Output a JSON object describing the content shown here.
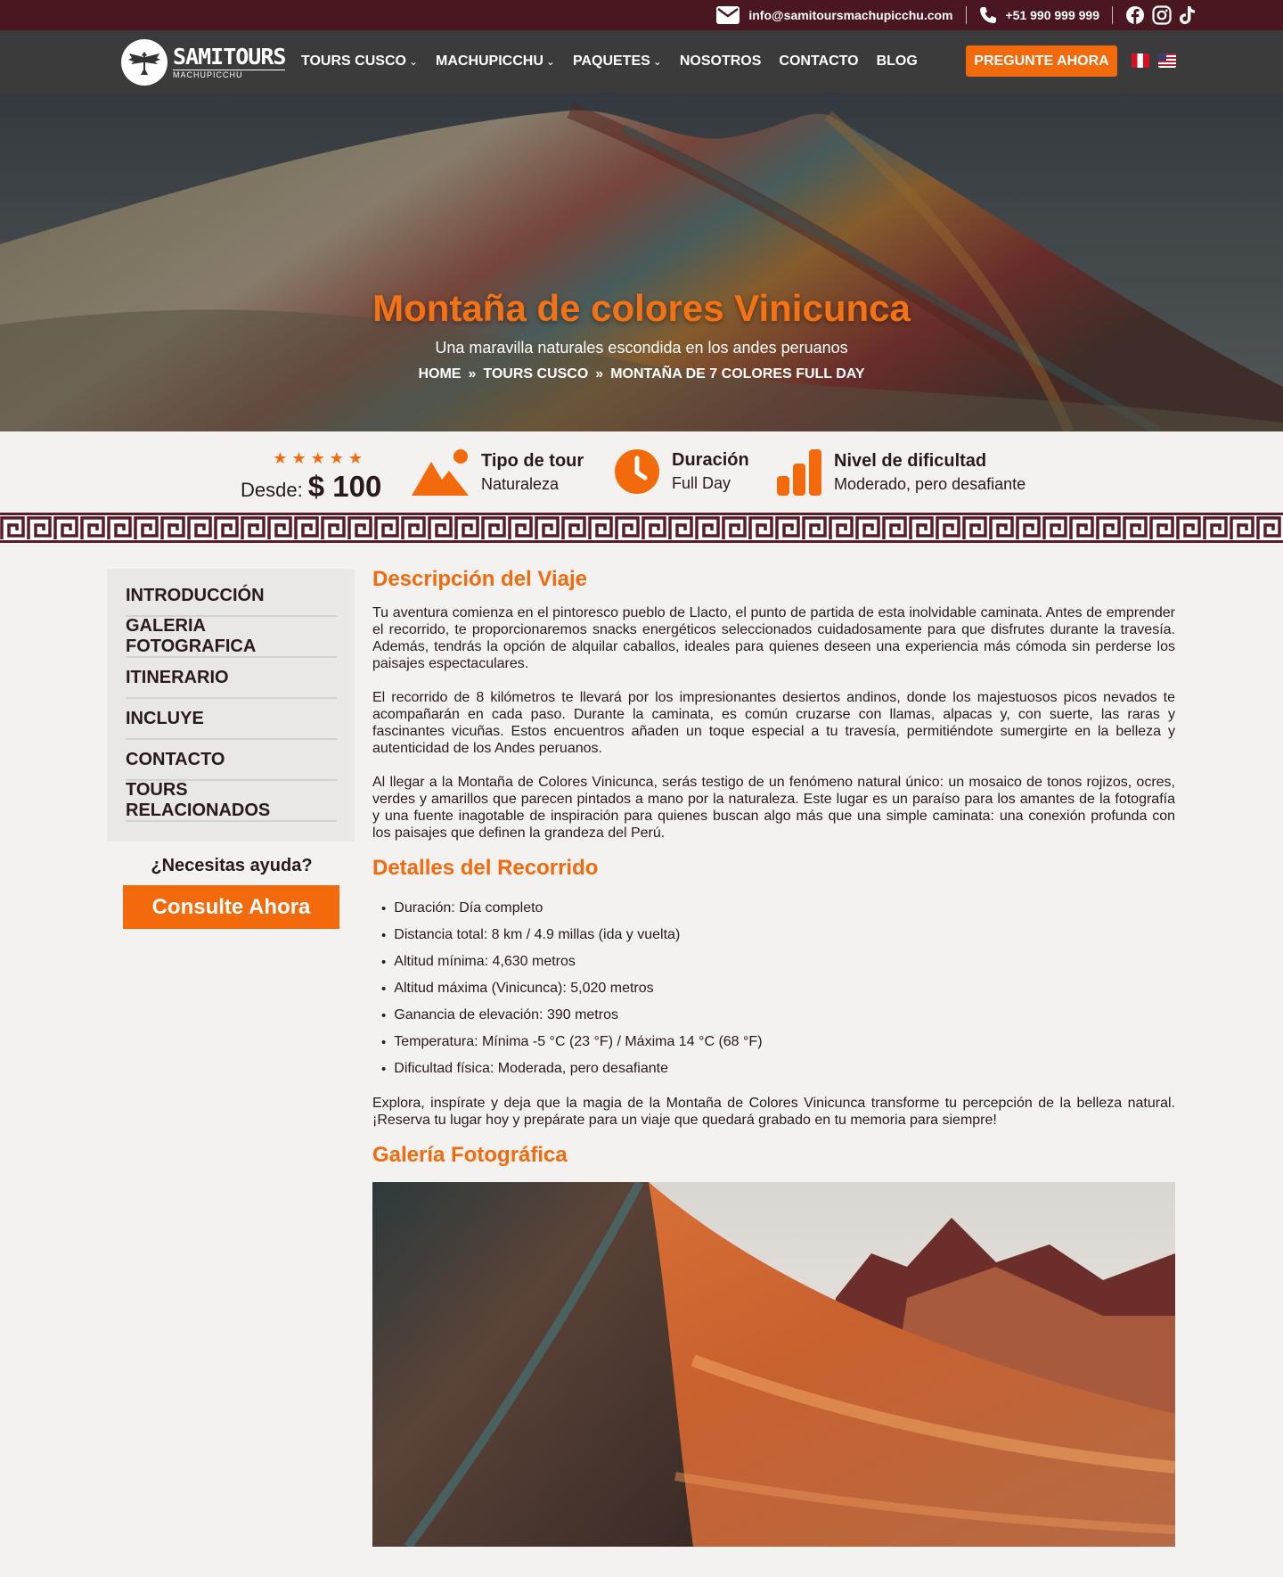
{
  "topbar": {
    "email": "info@samitoursmachupicchu.com",
    "phone": "+51 990 999 999",
    "socials": [
      "facebook-icon",
      "instagram-icon",
      "tiktok-icon"
    ]
  },
  "nav": {
    "logo_main": "SAMITOURS",
    "logo_sub": "MACHUPICCHU",
    "links": [
      "TOURS CUSCO",
      "MACHUPICCHU",
      "PAQUETES",
      "NOSOTROS",
      "CONTACTO",
      "BLOG"
    ],
    "cta": "PREGUNTE AHORA",
    "languages": [
      "peru-flag-icon",
      "usa-flag-icon"
    ]
  },
  "hero": {
    "title": "Montaña de colores Vinicunca",
    "subtitle": "Una maravilla naturales escondida en los andes peruanos",
    "breadcrumb": [
      "HOME",
      "TOURS CUSCO",
      "MONTAÑA DE 7 COLORES FULL DAY"
    ],
    "breadcrumb_sep": "»"
  },
  "info": {
    "rating": 5,
    "price_label": "Desde:",
    "price_value": "$ 100",
    "tour_type_title": "Tipo de tour",
    "tour_type_value": "Naturaleza",
    "duration_title": "Duración",
    "duration_value": "Full Day",
    "difficulty_title": "Nivel de dificultad",
    "difficulty_value": "Moderado, pero desafiante"
  },
  "sidebar": {
    "items": [
      "INTRODUCCIÓN",
      "GALERIA FOTOGRAFICA",
      "ITINERARIO",
      "INCLUYE",
      "CONTACTO",
      "TOURS RELACIONADOS"
    ],
    "help_title": "¿Necesitas ayuda?",
    "help_button": "Consulte Ahora"
  },
  "content": {
    "description_title": "Descripción del Viaje",
    "paragraphs": [
      "Tu aventura comienza en el pintoresco pueblo de Llacto, el punto de partida de esta inolvidable caminata. Antes de emprender el recorrido, te proporcionaremos snacks energéticos seleccionados cuidadosamente para que disfrutes durante la travesía. Además, tendrás la opción de alquilar caballos, ideales para quienes deseen una experiencia más cómoda sin perderse los paisajes espectaculares.",
      "El recorrido de 8 kilómetros te llevará por los impresionantes desiertos andinos, donde los majestuosos picos nevados te acompañarán en cada paso. Durante la caminata, es común cruzarse con llamas, alpacas y, con suerte, las raras y fascinantes vicuñas. Estos encuentros añaden un toque especial a tu travesía, permitiéndote sumergirte en la belleza y autenticidad de los Andes peruanos.",
      "Al llegar a la Montaña de Colores Vinicunca, serás testigo de un fenómeno natural único: un mosaico de tonos rojizos, ocres, verdes y amarillos que parecen pintados a mano por la naturaleza. Este lugar es un paraíso para los amantes de la fotografía y una fuente inagotable de inspiración para quienes buscan algo más que una simple caminata: una conexión profunda con los paisajes que definen la grandeza del Perú."
    ],
    "details_title": "Detalles del Recorrido",
    "details": [
      "Duración: Día completo",
      "Distancia total: 8 km / 4.9 millas (ida y vuelta)",
      "Altitud mínima: 4,630 metros",
      "Altitud máxima (Vinicunca): 5,020 metros",
      "Ganancia de elevación: 390 metros",
      "Temperatura: Mínima -5 °C (23 °F) / Máxima 14 °C (68 °F)",
      "Dificultad física: Moderada, pero desafiante"
    ],
    "closing": "Explora, inspírate y deja que la magia de la Montaña de Colores Vinicunca transforme tu percepción de la belleza natural. ¡Reserva tu lugar hoy y prepárate para un viaje que quedará grabado en tu memoria para siempre!",
    "gallery_title": "Galería Fotográfica"
  },
  "colors": {
    "accent": "#f26a0c",
    "topbar": "#4a1620",
    "nav": "#3b3b3c",
    "text": "#2a1a1c"
  }
}
